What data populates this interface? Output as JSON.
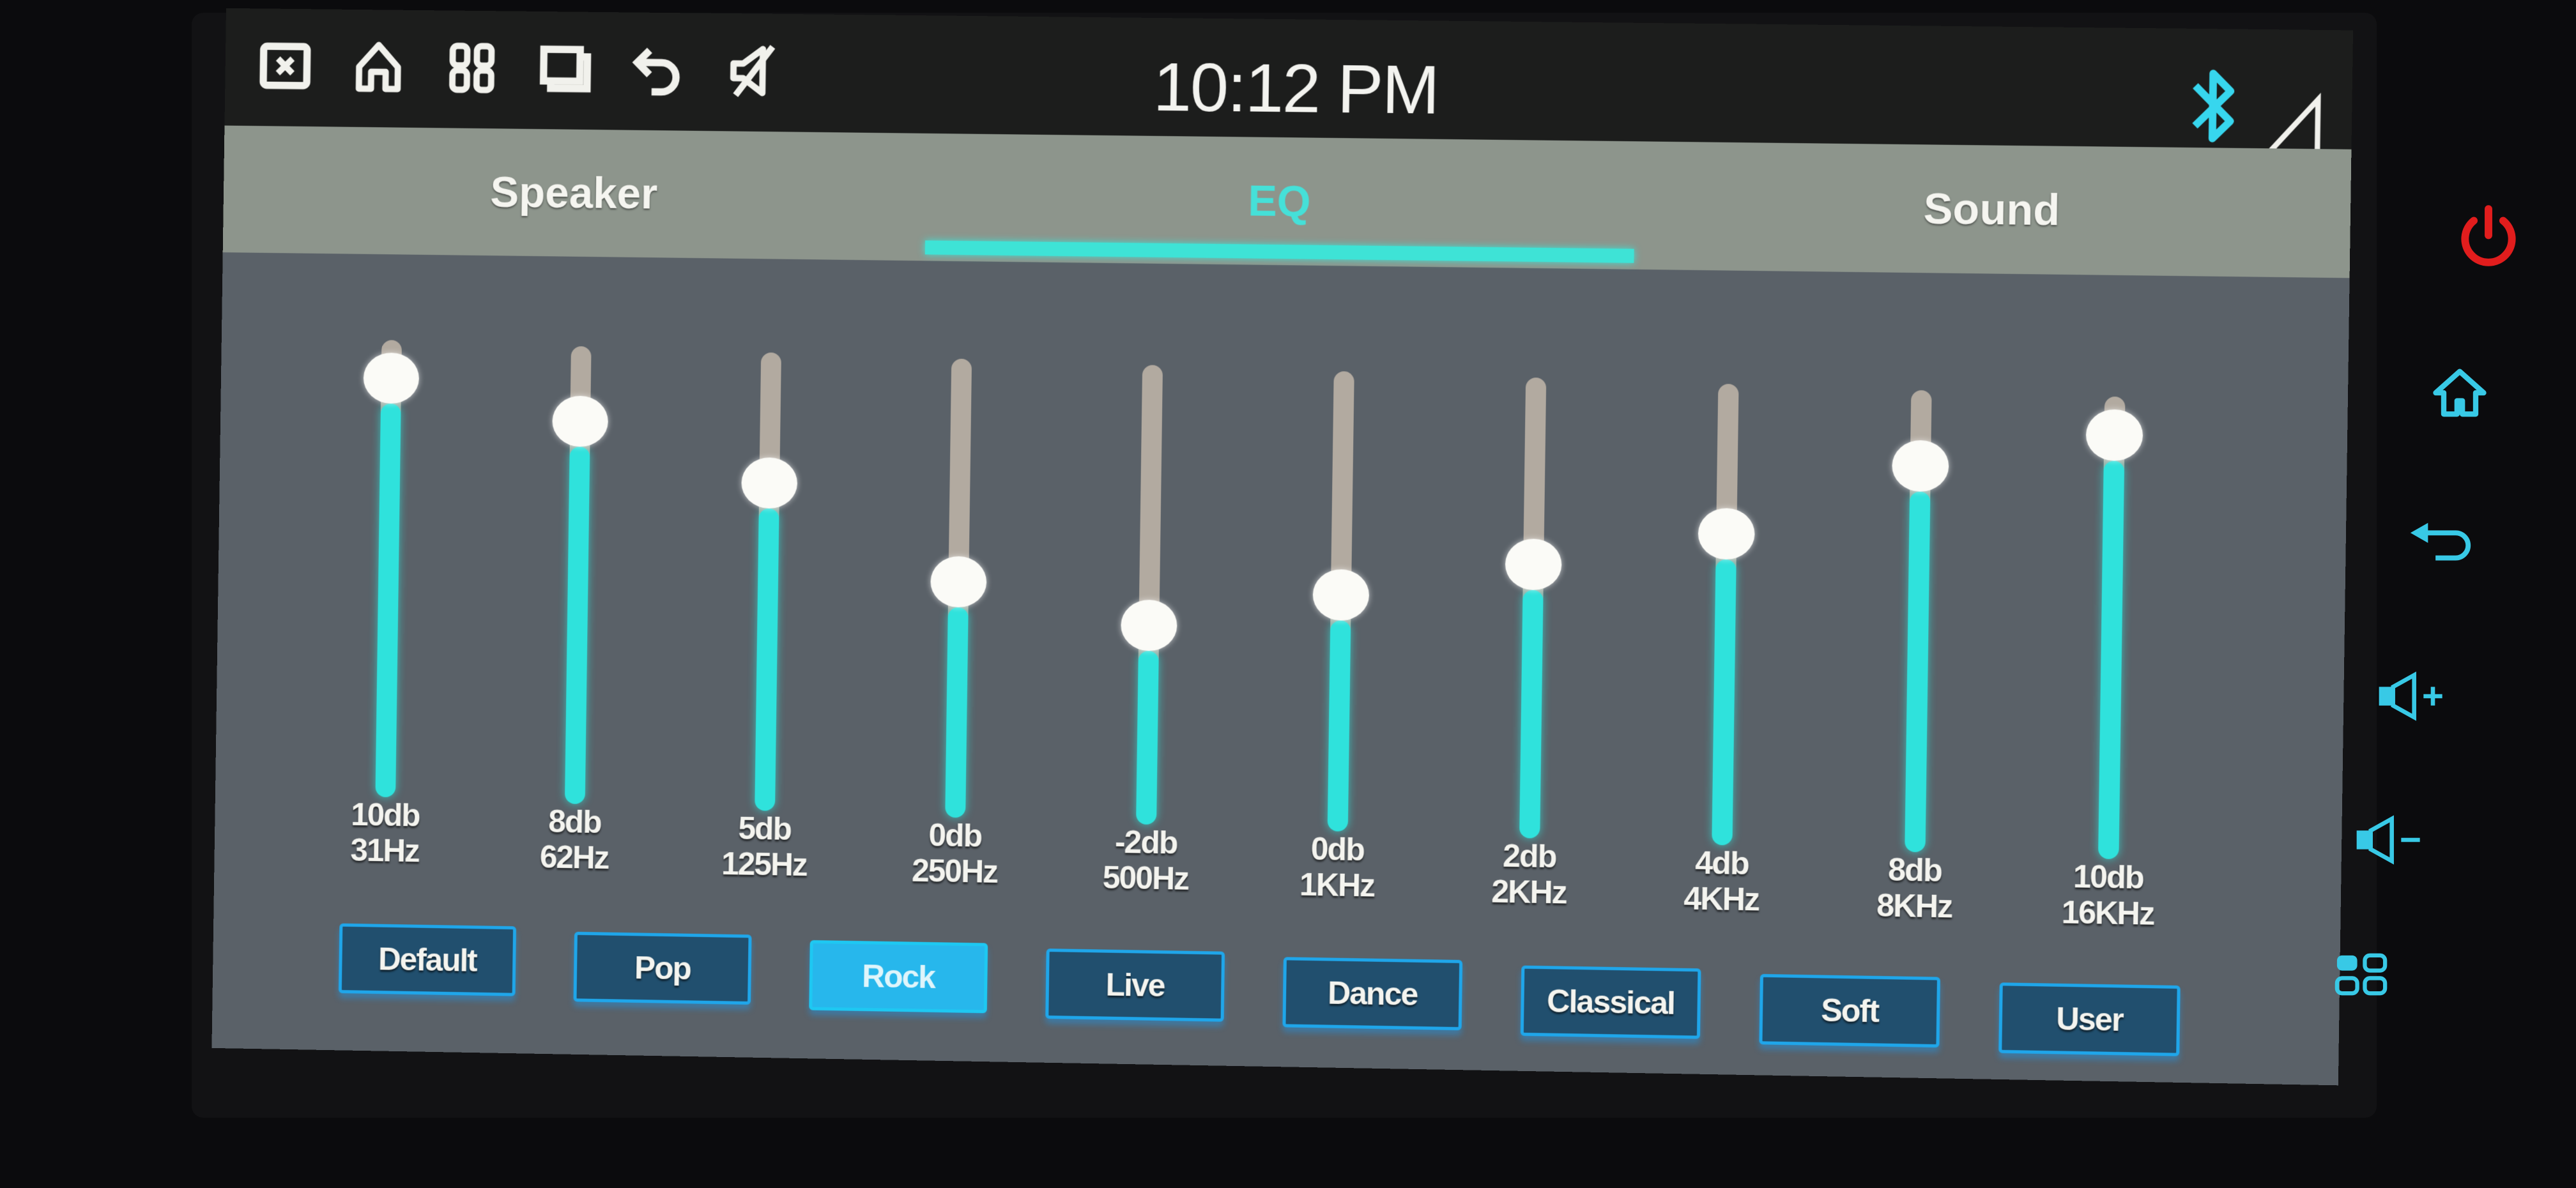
{
  "status_bar": {
    "icons": [
      {
        "name": "close-window-icon"
      },
      {
        "name": "home-icon"
      },
      {
        "name": "apps-grid-icon"
      },
      {
        "name": "recent-apps-icon"
      },
      {
        "name": "back-icon"
      },
      {
        "name": "mute-icon"
      }
    ],
    "time": "10:12 PM",
    "right_icons": [
      "bluetooth-icon",
      "signal-icon"
    ],
    "bluetooth_color": "#37d6ee"
  },
  "tabs": [
    {
      "label": "Speaker",
      "active": false
    },
    {
      "label": "EQ",
      "active": true
    },
    {
      "label": "Sound",
      "active": false
    }
  ],
  "eq": {
    "range_db": [
      -10,
      10
    ],
    "bands": [
      {
        "gain": "10db",
        "freq": "31Hz",
        "value": 10
      },
      {
        "gain": "8db",
        "freq": "62Hz",
        "value": 8
      },
      {
        "gain": "5db",
        "freq": "125Hz",
        "value": 5
      },
      {
        "gain": "0db",
        "freq": "250Hz",
        "value": 0
      },
      {
        "gain": "-2db",
        "freq": "500Hz",
        "value": -2
      },
      {
        "gain": "0db",
        "freq": "1KHz",
        "value": 0
      },
      {
        "gain": "2db",
        "freq": "2KHz",
        "value": 2
      },
      {
        "gain": "4db",
        "freq": "4KHz",
        "value": 4
      },
      {
        "gain": "8db",
        "freq": "8KHz",
        "value": 8
      },
      {
        "gain": "10db",
        "freq": "16KHz",
        "value": 10
      }
    ]
  },
  "presets": [
    {
      "label": "Default",
      "active": false
    },
    {
      "label": "Pop",
      "active": false
    },
    {
      "label": "Rock",
      "active": true
    },
    {
      "label": "Live",
      "active": false
    },
    {
      "label": "Dance",
      "active": false
    },
    {
      "label": "Classical",
      "active": false
    },
    {
      "label": "Soft",
      "active": false
    },
    {
      "label": "User",
      "active": false
    }
  ],
  "hardware_buttons": [
    {
      "name": "power-icon",
      "color": "#e11d1d"
    },
    {
      "name": "home-icon",
      "color": "#38c9e6"
    },
    {
      "name": "back-icon",
      "color": "#38c9e6"
    },
    {
      "name": "volume-up-icon",
      "color": "#38c9e6"
    },
    {
      "name": "volume-down-icon",
      "color": "#38c9e6"
    },
    {
      "name": "apps-grid-icon",
      "color": "#38c9e6"
    }
  ],
  "colors": {
    "accent": "#2fe2dc",
    "preset_border": "#1fa6ea",
    "preset_active": "#27b7ec"
  }
}
